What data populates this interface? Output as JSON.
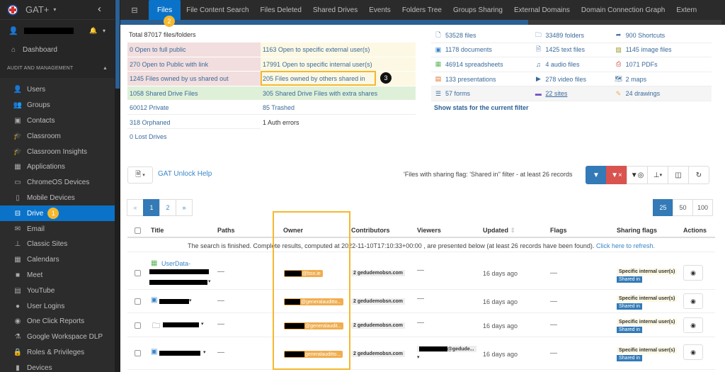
{
  "app": {
    "name": "GAT+"
  },
  "sidebar": {
    "dashboard": "Dashboard",
    "section": "AUDIT AND MANAGEMENT",
    "items": [
      {
        "label": "Users",
        "icon": "user-icon"
      },
      {
        "label": "Groups",
        "icon": "groups-icon"
      },
      {
        "label": "Contacts",
        "icon": "contacts-icon"
      },
      {
        "label": "Classroom",
        "icon": "graduation-cap-icon"
      },
      {
        "label": "Classroom Insights",
        "icon": "classroom-insights-icon"
      },
      {
        "label": "Applications",
        "icon": "grid-icon"
      },
      {
        "label": "ChromeOS Devices",
        "icon": "laptop-icon"
      },
      {
        "label": "Mobile Devices",
        "icon": "mobile-icon"
      },
      {
        "label": "Drive",
        "icon": "drive-icon",
        "active": true,
        "badge": "1"
      },
      {
        "label": "Email",
        "icon": "envelope-icon"
      },
      {
        "label": "Classic Sites",
        "icon": "sitemap-icon"
      },
      {
        "label": "Calendars",
        "icon": "calendar-icon"
      },
      {
        "label": "Meet",
        "icon": "video-camera-icon"
      },
      {
        "label": "YouTube",
        "icon": "film-icon"
      },
      {
        "label": "User Logins",
        "icon": "globe-icon"
      },
      {
        "label": "One Click Reports",
        "icon": "eye-icon"
      },
      {
        "label": "Google Workspace DLP",
        "icon": "flask-icon"
      },
      {
        "label": "Roles & Privileges",
        "icon": "lock-icon"
      },
      {
        "label": "Devices",
        "icon": "devices-icon"
      }
    ]
  },
  "tabs": [
    {
      "label": "Files",
      "active": true,
      "badge": "2"
    },
    {
      "label": "File Content Search"
    },
    {
      "label": "Files Deleted"
    },
    {
      "label": "Shared Drives"
    },
    {
      "label": "Events"
    },
    {
      "label": "Folders Tree"
    },
    {
      "label": "Groups Sharing"
    },
    {
      "label": "External Domains"
    },
    {
      "label": "Domain Connection Graph"
    },
    {
      "label": "Extern"
    }
  ],
  "stats": {
    "total": "Total 87017 files/folders",
    "rows": [
      [
        "0 Open to full public",
        "1163 Open to specific external user(s)"
      ],
      [
        "270 Open to Public with link",
        "17991 Open to specific internal user(s)"
      ],
      [
        "1245 Files owned by us shared out",
        "205 Files owned by others shared in"
      ],
      [
        "1058 Shared Drive Files",
        "305 Shared Drive Files with extra shares"
      ],
      [
        "60012 Private",
        "85 Trashed"
      ],
      [
        "318 Orphaned",
        "1 Auth errors"
      ],
      [
        "0 Lost Drives",
        ""
      ]
    ],
    "highlight_badge": "3"
  },
  "types": {
    "rows": [
      [
        {
          "label": "53528 files",
          "icon": "file-icon"
        },
        {
          "label": "33489 folders",
          "icon": "folder-icon"
        },
        {
          "label": "900 Shortcuts",
          "icon": "share-arrow-icon"
        }
      ],
      [
        {
          "label": "1178 documents",
          "icon": "document-icon"
        },
        {
          "label": "1425 text files",
          "icon": "text-file-icon"
        },
        {
          "label": "1145 image files",
          "icon": "image-file-icon"
        }
      ],
      [
        {
          "label": "46914 spreadsheets",
          "icon": "spreadsheet-icon"
        },
        {
          "label": "4 audio files",
          "icon": "audio-file-icon"
        },
        {
          "label": "1071 PDFs",
          "icon": "pdf-icon"
        }
      ],
      [
        {
          "label": "133 presentations",
          "icon": "presentation-icon"
        },
        {
          "label": "278 video files",
          "icon": "video-file-icon"
        },
        {
          "label": "2 maps",
          "icon": "map-icon"
        }
      ],
      [
        {
          "label": "57 forms",
          "icon": "form-icon"
        },
        {
          "label": "22 sites",
          "icon": "sites-icon"
        },
        {
          "label": "24 drawings",
          "icon": "drawing-icon"
        }
      ]
    ],
    "show_stats": "Show stats for the current filter"
  },
  "toolbar": {
    "unlock_help": "GAT Unlock Help",
    "filter_text": "'Files with sharing flag: 'Shared in'' filter -  at least 26 records"
  },
  "pagination": {
    "prev": "«",
    "pages": [
      "1",
      "2"
    ],
    "next": "»",
    "sizes": [
      "25",
      "50",
      "100"
    ],
    "current_size": "25"
  },
  "table": {
    "columns": [
      "Title",
      "Paths",
      "Owner",
      "Contributors",
      "Viewers",
      "Updated",
      "Flags",
      "Sharing flags",
      "Actions"
    ],
    "notice": "The search is finished. Complete results, computed at 2022-11-10T17:10:33+00:00 , are presented below (at least 26 records have been found).",
    "refresh": "Click here to refresh.",
    "rows": [
      {
        "title": "UserData-",
        "icon": "spreadsheet-icon",
        "paths": "—",
        "owner_domain": "@bsn.ie",
        "contributors": "2 gedudemobsn.com",
        "viewers": "—",
        "updated": "16 days ago",
        "flags": "—",
        "sharing": [
          "Specific internal user(s)",
          "Shared in"
        ]
      },
      {
        "title": "",
        "icon": "document-icon",
        "paths": "—",
        "owner_domain": "@generalauditto...",
        "contributors": "2 gedudemobsn.com",
        "viewers": "—",
        "updated": "16 days ago",
        "flags": "—",
        "sharing": [
          "Specific internal user(s)",
          "Shared in"
        ]
      },
      {
        "title": "",
        "icon": "folder-icon",
        "paths": "—",
        "owner_domain": "@generalaudit...",
        "contributors": "2 gedudemobsn.com",
        "viewers": "—",
        "updated": "16 days ago",
        "flags": "—",
        "sharing": [
          "Specific internal user(s)",
          "Shared in"
        ]
      },
      {
        "title": "",
        "icon": "document-icon",
        "paths": "—",
        "owner_domain": "generalauditto...",
        "contributors": "2 gedudemobsn.com",
        "viewers": "@gedude...",
        "updated": "16 days ago",
        "flags": "—",
        "sharing": [
          "Specific internal user(s)",
          "Shared in"
        ]
      }
    ]
  }
}
